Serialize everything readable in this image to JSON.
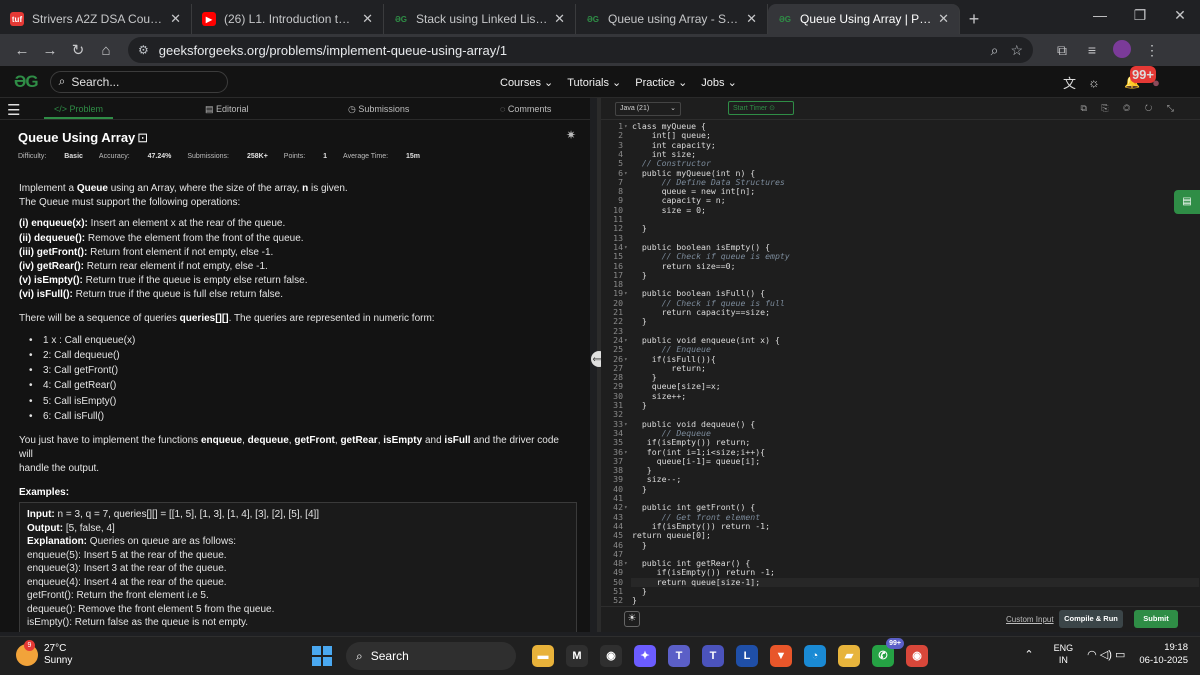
{
  "browser": {
    "tabs": [
      {
        "title": "Strivers A2Z DSA Course/Sheet",
        "icon": "tuf-icon",
        "close": "✕"
      },
      {
        "title": "(26) L1. Introduction to Stack an",
        "icon": "youtube-icon",
        "close": "✕"
      },
      {
        "title": "Stack using Linked List | Practic",
        "icon": "gfg-icon",
        "close": "✕"
      },
      {
        "title": "Queue using Array - Simple Imp",
        "icon": "gfg-icon",
        "close": "✕"
      },
      {
        "title": "Queue Using Array | Practice | G",
        "icon": "gfg-icon",
        "close": "✕",
        "active": true
      }
    ],
    "new_tab": "+",
    "window_controls": {
      "minimize": "—",
      "restore": "❐",
      "close": "✕"
    },
    "nav": {
      "back": "←",
      "forward": "→",
      "reload": "↻",
      "home": "⌂"
    },
    "url": "geeksforgeeks.org/problems/implement-queue-using-array/1",
    "tune_icon": "⚙",
    "zoom_icon": "⌕",
    "bookmark_icon": "☆",
    "extensions_icon": "⧉",
    "media_icon": "≡",
    "more_icon": "⋮"
  },
  "site": {
    "logo": "ƏG",
    "search_placeholder": "Search...",
    "search_icon": "⌕",
    "menu": [
      "Courses ⌄",
      "Tutorials ⌄",
      "Practice ⌄",
      "Jobs ⌄"
    ],
    "icons": {
      "translate": "文",
      "theme": "☼",
      "bell": "🔔",
      "avatar": "●"
    },
    "notification_badge": "99+",
    "accent": "#2f8d46"
  },
  "problem": {
    "tabs": {
      "problem": "</> Problem",
      "editorial": "▤ Editorial",
      "submissions": "◷ Submissions",
      "comments": "◌ Comments"
    },
    "hamburger": "☰",
    "title": "Queue Using Array",
    "title_icon": "⊡",
    "bug_icon": "✷",
    "meta": {
      "difficulty_label": "Difficulty:",
      "difficulty": "Basic",
      "accuracy_label": "Accuracy:",
      "accuracy": "47.24%",
      "submissions_label": "Submissions:",
      "submissions": "258K+",
      "points_label": "Points:",
      "points": "1",
      "time_label": "Average Time:",
      "time": "15m"
    },
    "intro": {
      "p1_a": "Implement a ",
      "p1_queue": "Queue",
      "p1_b": " using an Array, where the size of the array, ",
      "p1_n": "n",
      "p1_c": " is given.",
      "p2": "The Queue must support the following operations:"
    },
    "operations": [
      {
        "name": "(i) enqueue(x):",
        "text": " Insert an element x at the rear of the queue."
      },
      {
        "name": "(ii) dequeue():",
        "text": " Remove the element from the front of the queue."
      },
      {
        "name": "(iii) getFront():",
        "text": " Return front element if not empty, else -1."
      },
      {
        "name": "(iv) getRear():",
        "text": " Return rear element if not empty, else -1."
      },
      {
        "name": "(v) isEmpty():",
        "text": " Return true if the queue is empty else return false."
      },
      {
        "name": "(vi) isFull():",
        "text": " Return true if the queue is full else return false."
      }
    ],
    "queries_a": "There will be a sequence of queries ",
    "queries_b": "queries[][]",
    "queries_c": ". The queries are represented in numeric form:",
    "query_list": [
      "1 x : Call enqueue(x)",
      "2: Call dequeue()",
      "3: Call getFront()",
      "4: Call getRear()",
      "5: Call isEmpty()",
      "6: Call isFull()"
    ],
    "implement": {
      "a": "You just have to implement the functions ",
      "f1": "enqueue",
      "c1": ", ",
      "f2": "dequeue",
      "c2": ", ",
      "f3": "getFront",
      "c3": ", ",
      "f4": "getRear",
      "c4": ", ",
      "f5": "isEmpty",
      "c5": " and ",
      "f6": "isFull",
      "b": " and the driver code will",
      "line2": "handle the output."
    },
    "examples_heading": "Examples:",
    "example": {
      "input_label": "Input:",
      "input": " n = 3, q = 7, queries[][] = [[1, 5], [1, 3], [1, 4], [3], [2], [5], [4]]",
      "output_label": "Output:",
      "output": " [5, false, 4]",
      "explanation_label": "Explanation:",
      "explanation": " Queries on queue are as follows:",
      "lines": [
        "enqueue(5): Insert 5 at the rear of the queue.",
        "enqueue(3): Insert 3 at the rear of the queue.",
        "enqueue(4): Insert 4 at the rear of the queue.",
        "getFront(): Return the front element i.e 5.",
        "dequeue(): Remove the front element 5 from the queue.",
        "isEmpty(): Return false as the queue is not empty."
      ]
    }
  },
  "editor": {
    "language": "Java (21)",
    "language_caret": "⌄",
    "timer": "Start Timer ⊙",
    "toolbar_icons": "⧉ ⎘ ◎ ↻ ⤡",
    "splitter_icon": "⟺",
    "bulb_icon": "☀",
    "custom_input": "Custom Input",
    "compile": "Compile & Run",
    "submit": "Submit",
    "chat_icon": "▤",
    "lines": [
      "class myQueue {",
      "    int[] queue;",
      "    int capacity;",
      "    int size;",
      "  // Constructor",
      "  public myQueue(int n) {",
      "      // Define Data Structures",
      "      queue = new int[n];",
      "      capacity = n;",
      "      size = 0;",
      "",
      "  }",
      "",
      "  public boolean isEmpty() {",
      "      // Check if queue is empty",
      "      return size==0;",
      "  }",
      "",
      "  public boolean isFull() {",
      "      // Check if queue is full",
      "      return capacity==size;",
      "  }",
      "",
      "  public void enqueue(int x) {",
      "      // Enqueue",
      "    if(isFull()){",
      "        return;",
      "    }",
      "    queue[size]=x;",
      "    size++;",
      "  }",
      "",
      "  public void dequeue() {",
      "      // Dequeue",
      "   if(isEmpty()) return;",
      "   for(int i=1;i<size;i++){",
      "     queue[i-1]= queue[i];",
      "   }",
      "   size--;",
      "  }",
      "",
      "  public int getFront() {",
      "      // Get front element",
      "    if(isEmpty()) return -1;",
      "return queue[0];",
      "  }",
      "",
      "  public int getRear() {",
      "     if(isEmpty()) return -1;",
      "     return queue[size-1];",
      "  }",
      "}"
    ],
    "fold_lines": [
      1,
      6,
      14,
      19,
      24,
      26,
      33,
      36,
      42,
      48
    ],
    "fold_glyph": "▾",
    "comment_lines": [
      5,
      7,
      15,
      20,
      25,
      34,
      43
    ],
    "current_line": 50
  },
  "taskbar": {
    "weather_temp": "27°C",
    "weather_desc": "Sunny",
    "weather_badge": "9",
    "search": "Search",
    "search_icon": "⌕",
    "apps": [
      {
        "name": "file-explorer-icon",
        "glyph": "▬",
        "color": "#e8b23a"
      },
      {
        "name": "gmail-icon",
        "glyph": "M",
        "color": "#2f2f2f"
      },
      {
        "name": "chrome-icon",
        "glyph": "◉",
        "color": "#2f2f2f"
      },
      {
        "name": "copilot-icon",
        "glyph": "✦",
        "color": "#6b5cff"
      },
      {
        "name": "teams-icon",
        "glyph": "T",
        "color": "#5b5fc7"
      },
      {
        "name": "teams-work-icon",
        "glyph": "T",
        "color": "#4b53bc"
      },
      {
        "name": "l-app-icon",
        "glyph": "L",
        "color": "#1f4fa8"
      },
      {
        "name": "brave-icon",
        "glyph": "▼",
        "color": "#e8562a"
      },
      {
        "name": "edge-icon",
        "glyph": "◔",
        "color": "#1a8ad4"
      },
      {
        "name": "folder-icon",
        "glyph": "▰",
        "color": "#e7b43c"
      },
      {
        "name": "whatsapp-icon",
        "glyph": "✆",
        "color": "#25a244"
      },
      {
        "name": "chrome-active-icon",
        "glyph": "◉",
        "color": "#d8473a"
      }
    ],
    "whatsapp_badge": "99+",
    "tray_up": "⌃",
    "lang": "ENG",
    "region": "IN",
    "tray_icons": "◠ ◁) ▭",
    "time": "19:18",
    "date": "06-10-2025"
  }
}
